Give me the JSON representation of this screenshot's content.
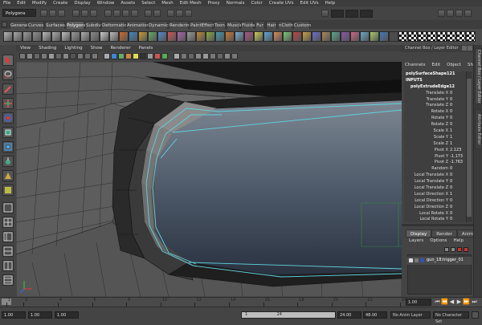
{
  "menubar": [
    "File",
    "Edit",
    "Modify",
    "Create",
    "Display",
    "Window",
    "Assets",
    "Select",
    "Mesh",
    "Edit Mesh",
    "Proxy",
    "Normals",
    "Color",
    "Create UVs",
    "Edit UVs",
    "Help"
  ],
  "status_line": {
    "mode": "Polygons"
  },
  "shelf_tabs": [
    "General",
    "Curves",
    "Surfaces",
    "Polygons",
    "Subdivs",
    "Deformation",
    "Animation",
    "Dynamics",
    "Rendering",
    "PaintEffects",
    "Toon",
    "Muscle",
    "Fluids",
    "Fur",
    "Hair",
    "nCloth",
    "Custom"
  ],
  "active_shelf_tab": "Polygons",
  "panel_menu": [
    "View",
    "Shading",
    "Lighting",
    "Show",
    "Renderer",
    "Panels"
  ],
  "channel_box": {
    "title": "Channel Box / Layer Editor",
    "menu": [
      "Channels",
      "Edit",
      "Object",
      "Show"
    ],
    "object_name": "polySurfaceShape121",
    "inputs_label": "INPUTS",
    "node_name": "polyExtrudeEdge12",
    "attributes": [
      {
        "name": "Translate X",
        "value": "0"
      },
      {
        "name": "Translate Y",
        "value": "0"
      },
      {
        "name": "Translate Z",
        "value": "0"
      },
      {
        "name": "Rotate X",
        "value": "0"
      },
      {
        "name": "Rotate Y",
        "value": "0"
      },
      {
        "name": "Rotate Z",
        "value": "0"
      },
      {
        "name": "Scale X",
        "value": "1"
      },
      {
        "name": "Scale Y",
        "value": "1"
      },
      {
        "name": "Scale Z",
        "value": "1"
      },
      {
        "name": "Pivot X",
        "value": "2.123"
      },
      {
        "name": "Pivot Y",
        "value": "-1.173"
      },
      {
        "name": "Pivot Z",
        "value": "-1.763"
      },
      {
        "name": "Random",
        "value": "0"
      },
      {
        "name": "Local Translate X",
        "value": "0"
      },
      {
        "name": "Local Translate Y",
        "value": "0"
      },
      {
        "name": "Local Translate Z",
        "value": "0"
      },
      {
        "name": "Local Direction X",
        "value": "1"
      },
      {
        "name": "Local Direction Y",
        "value": "0"
      },
      {
        "name": "Local Direction Z",
        "value": "0"
      },
      {
        "name": "Local Rotate X",
        "value": "0"
      },
      {
        "name": "Local Rotate Y",
        "value": "0"
      }
    ]
  },
  "side_tabs": [
    "Channel Box / Layer Editor",
    "Attribute Editor"
  ],
  "layer_editor": {
    "tabs": [
      "Display",
      "Render",
      "Anim"
    ],
    "active_tab": "Display",
    "menu": [
      "Layers",
      "Options",
      "Help"
    ],
    "layer_name": "gun_18:trigger_01"
  },
  "time_slider": {
    "ticks": [
      "1",
      "2",
      "4",
      "6",
      "8",
      "10",
      "12",
      "14",
      "16",
      "18",
      "20",
      "22",
      "24"
    ]
  },
  "range": {
    "start": "1.00",
    "current": "1.00",
    "range_start": "1.00",
    "range_start2": "1.00",
    "slider_start": "1",
    "slider_end": "24",
    "range_end": "24.00",
    "end": "48.00",
    "anim_layer": "No Anim Layer",
    "char_set": "No Character Set"
  },
  "colors": {
    "accent": "#5fd4e0",
    "selected_tab": "#5d5d5d",
    "viewport_bg_top": "#777777",
    "viewport_bg_bottom": "#3a3a3a"
  }
}
